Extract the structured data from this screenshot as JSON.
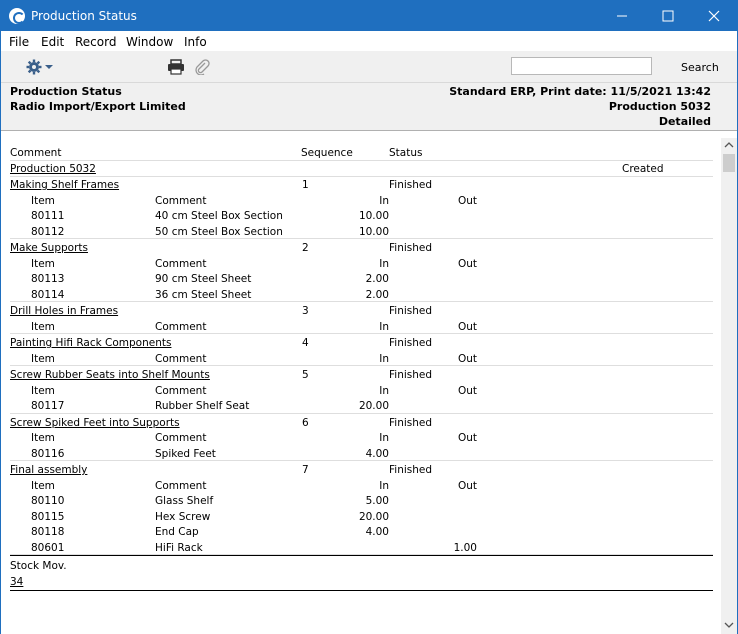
{
  "window": {
    "title": "Production Status",
    "accent": "#1f6fbf"
  },
  "menu": [
    "File",
    "Edit",
    "Record",
    "Window",
    "Info"
  ],
  "toolbar": {
    "search_label": "Search",
    "search_value": "",
    "icons": [
      "gear-icon",
      "printer-icon",
      "paperclip-icon"
    ]
  },
  "header": {
    "report_name": "Production Status",
    "company": "Radio Import/Export Limited",
    "print_info": "Standard ERP, Print date: 11/5/2021 13:42",
    "production": "Production 5032",
    "detail_level": "Detailed"
  },
  "report": {
    "columns": {
      "comment": "Comment",
      "sequence": "Sequence",
      "status": "Status"
    },
    "production_title": "Production 5032",
    "production_status": "Created",
    "sub_columns": {
      "item": "Item",
      "comment": "Comment",
      "in": "In",
      "out": "Out"
    },
    "steps": [
      {
        "name": "Making Shelf Frames",
        "seq": "1",
        "status": "Finished",
        "items": [
          {
            "item": "80111",
            "comment": "40 cm Steel Box Section",
            "in": "10.00",
            "out": ""
          },
          {
            "item": "80112",
            "comment": "50 cm Steel Box Section",
            "in": "10.00",
            "out": ""
          }
        ]
      },
      {
        "name": "Make Supports",
        "seq": "2",
        "status": "Finished",
        "items": [
          {
            "item": "80113",
            "comment": "90 cm Steel Sheet",
            "in": "2.00",
            "out": ""
          },
          {
            "item": "80114",
            "comment": "36 cm Steel Sheet",
            "in": "2.00",
            "out": ""
          }
        ]
      },
      {
        "name": "Drill Holes in Frames",
        "seq": "3",
        "status": "Finished",
        "items": []
      },
      {
        "name": "Painting Hifi Rack Components",
        "seq": "4",
        "status": "Finished",
        "items": []
      },
      {
        "name": "Screw Rubber Seats into Shelf Mounts",
        "seq": "5",
        "status": "Finished",
        "items": [
          {
            "item": "80117",
            "comment": "Rubber Shelf Seat",
            "in": "20.00",
            "out": ""
          }
        ]
      },
      {
        "name": "Screw Spiked Feet into Supports",
        "seq": "6",
        "status": "Finished",
        "items": [
          {
            "item": "80116",
            "comment": "Spiked Feet",
            "in": "4.00",
            "out": ""
          }
        ]
      },
      {
        "name": "Final assembly",
        "seq": "7",
        "status": "Finished",
        "items": [
          {
            "item": "80110",
            "comment": "Glass Shelf",
            "in": "5.00",
            "out": ""
          },
          {
            "item": "80115",
            "comment": "Hex Screw",
            "in": "20.00",
            "out": ""
          },
          {
            "item": "80118",
            "comment": "End Cap",
            "in": "4.00",
            "out": ""
          },
          {
            "item": "80601",
            "comment": "HiFi Rack",
            "in": "",
            "out": "1.00"
          }
        ]
      }
    ],
    "stock_mov_label": "Stock Mov.",
    "stock_mov_value": "34"
  }
}
